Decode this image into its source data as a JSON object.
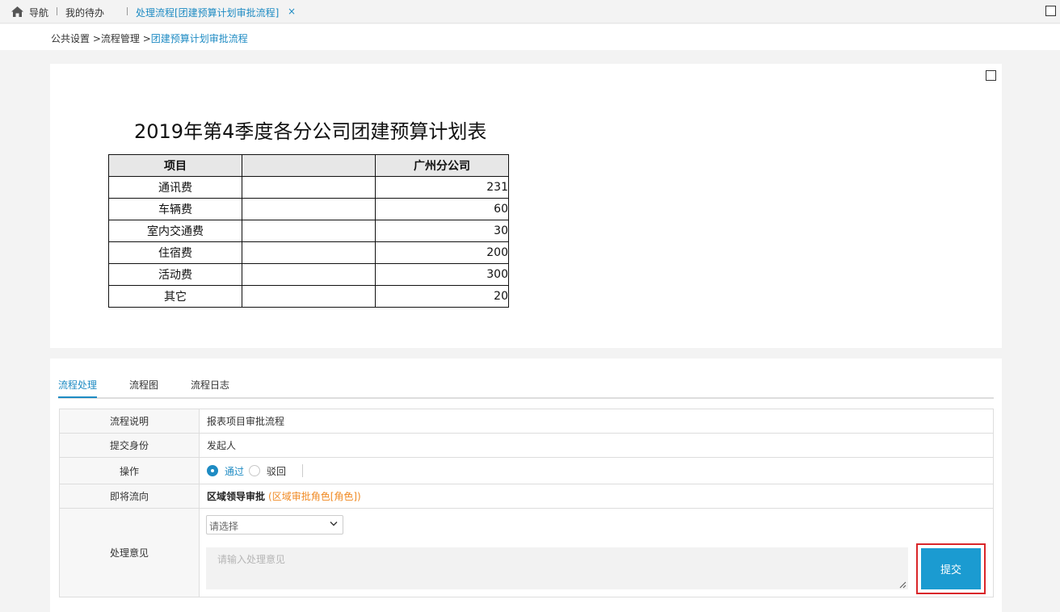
{
  "topbar": {
    "nav_label": "导航",
    "todo_tab": "我的待办",
    "active_tab": "处理流程[团建预算计划审批流程]",
    "close_symbol": "×"
  },
  "breadcrumb": {
    "items": [
      "公共设置",
      "流程管理"
    ],
    "separator": " >",
    "current": "团建预算计划审批流程"
  },
  "report": {
    "title": "2019年第4季度各分公司团建预算计划表",
    "headers": [
      "项目",
      "",
      "广州分公司"
    ],
    "rows": [
      {
        "item": "通讯费",
        "value": "231"
      },
      {
        "item": "车辆费",
        "value": "60"
      },
      {
        "item": "室内交通费",
        "value": "30"
      },
      {
        "item": "住宿费",
        "value": "200"
      },
      {
        "item": "活动费",
        "value": "300"
      },
      {
        "item": "其它",
        "value": "20"
      }
    ]
  },
  "panel": {
    "tabs": [
      "流程处理",
      "流程图",
      "流程日志"
    ],
    "form": {
      "desc_label": "流程说明",
      "desc_value": "报表项目审批流程",
      "identity_label": "提交身份",
      "identity_value": "发起人",
      "action_label": "操作",
      "action_options": [
        "通过",
        "驳回"
      ],
      "action_selected": "通过",
      "next_label": "即将流向",
      "next_node": "区域领导审批",
      "next_role": "(区域审批角色[角色])",
      "opinion_label": "处理意见",
      "opinion_select_placeholder": "请选择",
      "opinion_placeholder": "请输入处理意见",
      "submit_label": "提交"
    }
  },
  "colors": {
    "accent": "#1e8bc3",
    "submit": "#1b9bd1",
    "highlight_border": "#d9262a",
    "role_text": "#f08a24"
  }
}
